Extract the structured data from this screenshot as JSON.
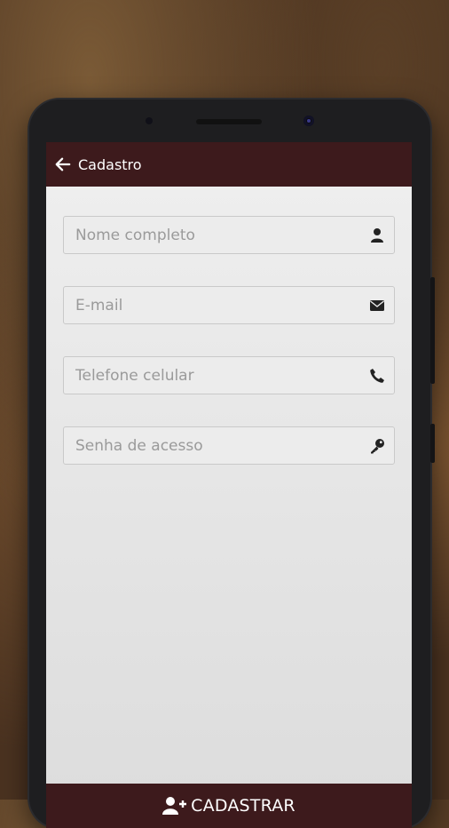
{
  "header": {
    "title": "Cadastro",
    "back_icon": "arrow-left-icon"
  },
  "form": {
    "fields": [
      {
        "placeholder": "Nome completo",
        "value": "",
        "icon": "user-icon"
      },
      {
        "placeholder": "E-mail",
        "value": "",
        "icon": "envelope-icon"
      },
      {
        "placeholder": "Telefone celular",
        "value": "",
        "icon": "phone-icon"
      },
      {
        "placeholder": "Senha de acesso",
        "value": "",
        "icon": "key-icon"
      }
    ]
  },
  "footer": {
    "submit_label": "CADASTRAR",
    "submit_icon": "user-plus-icon"
  },
  "colors": {
    "primary": "#3d1a1c",
    "screen_bg": "#e6e6e6",
    "field_border": "#c9c9c9"
  }
}
